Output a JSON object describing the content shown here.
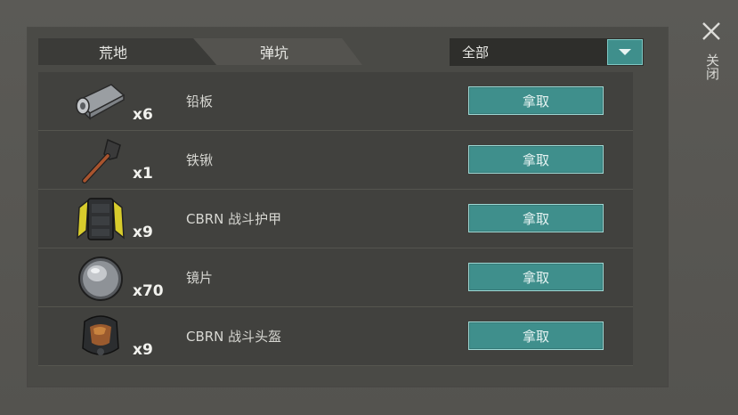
{
  "tabs": [
    {
      "label": "荒地"
    },
    {
      "label": "弹坑"
    }
  ],
  "filter": {
    "selected": "全部"
  },
  "close_label": "关闭",
  "accent_color": "#3f8f8c",
  "items": [
    {
      "name": "铅板",
      "qty": "x6",
      "icon": "lead-sheet-roll-icon",
      "button": "拿取"
    },
    {
      "name": "铁锹",
      "qty": "x1",
      "icon": "shovel-icon",
      "button": "拿取"
    },
    {
      "name": "CBRN 战斗护甲",
      "qty": "x9",
      "icon": "armor-vest-icon",
      "button": "拿取"
    },
    {
      "name": "镜片",
      "qty": "x70",
      "icon": "lens-icon",
      "button": "拿取"
    },
    {
      "name": "CBRN 战斗头盔",
      "qty": "x9",
      "icon": "gas-mask-helmet-icon",
      "button": "拿取"
    }
  ]
}
